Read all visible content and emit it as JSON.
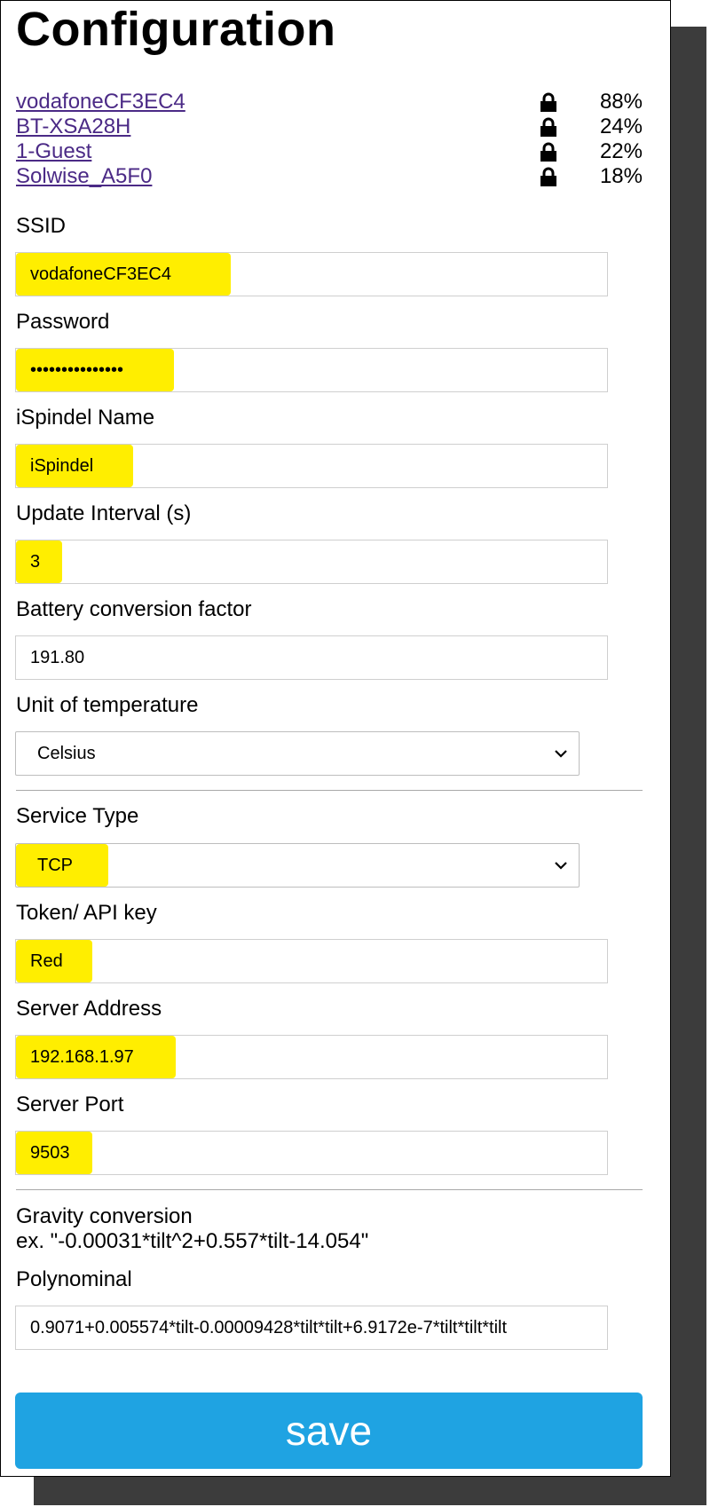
{
  "page": {
    "title": "Configuration"
  },
  "networks": [
    {
      "ssid": "vodafoneCF3EC4",
      "signal": "88%",
      "icon": "lock-icon"
    },
    {
      "ssid": "BT-XSA28H",
      "signal": "24%",
      "icon": "lock-icon"
    },
    {
      "ssid": "1-Guest",
      "signal": "22%",
      "icon": "lock-icon"
    },
    {
      "ssid": "Solwise_A5F0",
      "signal": "18%",
      "icon": "lock-icon"
    }
  ],
  "fields": {
    "ssid": {
      "label": "SSID",
      "value": "vodafoneCF3EC4"
    },
    "password": {
      "label": "Password",
      "value": "•••••••••••••••"
    },
    "name": {
      "label": "iSpindel Name",
      "value": "iSpindel"
    },
    "interval": {
      "label": "Update Interval (s)",
      "value": "3"
    },
    "battery": {
      "label": "Battery conversion factor",
      "value": "191.80"
    },
    "temp_unit": {
      "label": "Unit of temperature",
      "value": "Celsius"
    },
    "service": {
      "label": "Service Type",
      "value": "TCP"
    },
    "token": {
      "label": "Token/ API key",
      "value": "Red"
    },
    "server": {
      "label": "Server Address",
      "value": "192.168.1.97"
    },
    "port": {
      "label": "Server Port",
      "value": "9503"
    },
    "gravity": {
      "label": "Gravity conversion",
      "example": "ex. \"-0.00031*tilt^2+0.557*tilt-14.054\""
    },
    "polynomial": {
      "label": "Polynominal",
      "value": "0.9071+0.005574*tilt-0.00009428*tilt*tilt+6.9172e-7*tilt*tilt*tilt"
    }
  },
  "actions": {
    "save_label": "save"
  },
  "colors": {
    "highlight": "#ffee00",
    "link": "#4b2a86",
    "save_button": "#1fa3e2",
    "shadow": "#3c3c3c"
  }
}
